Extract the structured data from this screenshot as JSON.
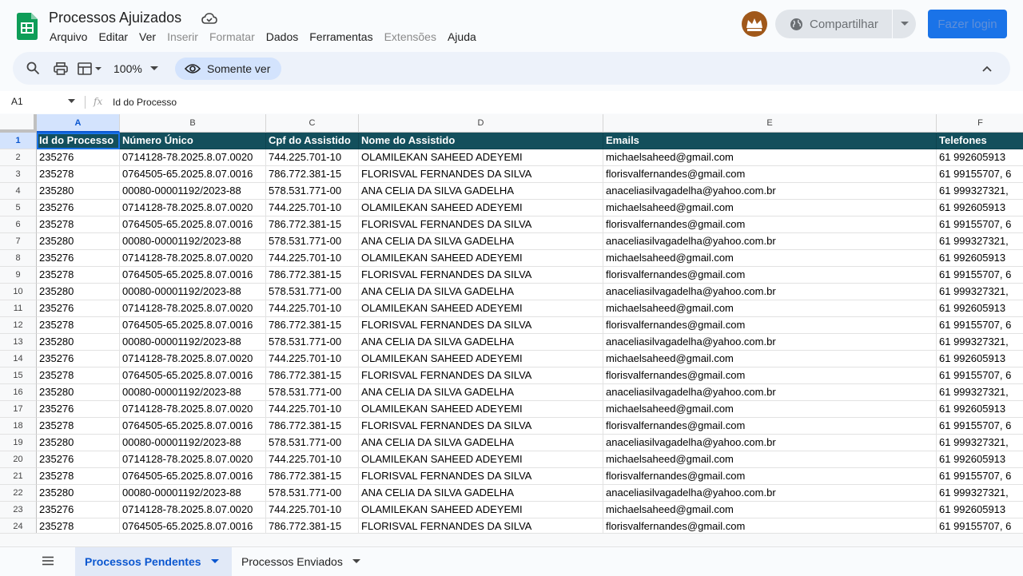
{
  "app": {
    "title": "Processos Ajuizados",
    "colors": {
      "sheets_green": "#0f9d58",
      "header_fill": "#134f5c",
      "accent": "#1a73e8"
    }
  },
  "menu": [
    {
      "label": "Arquivo",
      "disabled": false
    },
    {
      "label": "Editar",
      "disabled": false
    },
    {
      "label": "Ver",
      "disabled": false
    },
    {
      "label": "Inserir",
      "disabled": true
    },
    {
      "label": "Formatar",
      "disabled": true
    },
    {
      "label": "Dados",
      "disabled": false
    },
    {
      "label": "Ferramentas",
      "disabled": false
    },
    {
      "label": "Extensões",
      "disabled": true
    },
    {
      "label": "Ajuda",
      "disabled": false
    }
  ],
  "header": {
    "share_label": "Compartilhar",
    "login_label": "Fazer login"
  },
  "toolbar": {
    "zoom": "100%",
    "view_only_label": "Somente ver"
  },
  "formula_bar": {
    "cell_ref": "A1",
    "fx": "fx",
    "content": "Id do Processo"
  },
  "grid": {
    "columns": [
      "A",
      "B",
      "C",
      "D",
      "E",
      "F"
    ],
    "active_column": "A",
    "header_row": [
      "Id do Processo",
      "Número Único",
      "Cpf do Assistido",
      "Nome do Assistido",
      "Emails",
      "Telefones"
    ],
    "records": [
      [
        "235276",
        " 0714128-78.2025.8.07.0020",
        "744.225.701-10",
        "OLAMILEKAN SAHEED ADEYEMI",
        "michaelsaheed@gmail.com",
        "61 992605913"
      ],
      [
        "235278",
        "0764505-65.2025.8.07.0016",
        "786.772.381-15",
        "FLORISVAL FERNANDES DA SILVA",
        "florisvalfernandes@gmail.com",
        "61 99155707, 6"
      ],
      [
        "235280",
        "00080-00001192/2023-88",
        "578.531.771-00",
        "ANA CELIA DA SILVA GADELHA",
        "anaceliasilvagadelha@yahoo.com.br",
        "61 999327321,"
      ]
    ],
    "row_numbers": [
      "1",
      "2",
      "3",
      "4",
      "5",
      "6",
      "7",
      "8",
      "9",
      "10",
      "11",
      "12",
      "13",
      "14",
      "15",
      "16",
      "17",
      "18",
      "19",
      "20",
      "21",
      "22",
      "23",
      "24"
    ]
  },
  "tabs": [
    {
      "label": "Processos Pendentes",
      "active": true
    },
    {
      "label": "Processos Enviados",
      "active": false
    }
  ],
  "icons": [
    "sheets-logo-icon",
    "cloud-saved-icon",
    "avatar-crown-icon",
    "globe-icon",
    "chevron-down-icon",
    "search-icon",
    "print-icon",
    "paint-format-icon",
    "eye-icon",
    "chevron-up-icon",
    "all-sheets-icon"
  ]
}
